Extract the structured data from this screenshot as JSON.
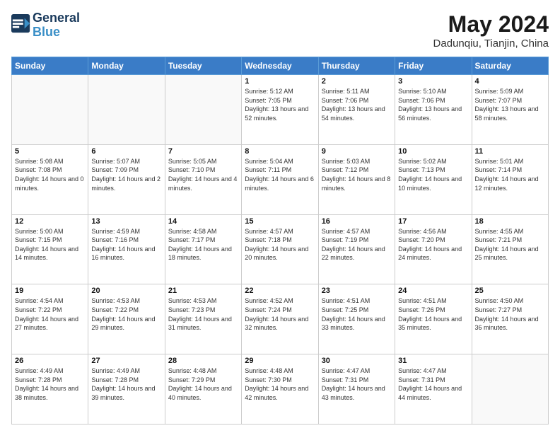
{
  "header": {
    "logo_line1": "General",
    "logo_line2": "Blue",
    "title": "May 2024",
    "subtitle": "Dadunqiu, Tianjin, China"
  },
  "weekdays": [
    "Sunday",
    "Monday",
    "Tuesday",
    "Wednesday",
    "Thursday",
    "Friday",
    "Saturday"
  ],
  "weeks": [
    [
      {
        "day": "",
        "info": ""
      },
      {
        "day": "",
        "info": ""
      },
      {
        "day": "",
        "info": ""
      },
      {
        "day": "1",
        "info": "Sunrise: 5:12 AM\nSunset: 7:05 PM\nDaylight: 13 hours and 52 minutes."
      },
      {
        "day": "2",
        "info": "Sunrise: 5:11 AM\nSunset: 7:06 PM\nDaylight: 13 hours and 54 minutes."
      },
      {
        "day": "3",
        "info": "Sunrise: 5:10 AM\nSunset: 7:06 PM\nDaylight: 13 hours and 56 minutes."
      },
      {
        "day": "4",
        "info": "Sunrise: 5:09 AM\nSunset: 7:07 PM\nDaylight: 13 hours and 58 minutes."
      }
    ],
    [
      {
        "day": "5",
        "info": "Sunrise: 5:08 AM\nSunset: 7:08 PM\nDaylight: 14 hours and 0 minutes."
      },
      {
        "day": "6",
        "info": "Sunrise: 5:07 AM\nSunset: 7:09 PM\nDaylight: 14 hours and 2 minutes."
      },
      {
        "day": "7",
        "info": "Sunrise: 5:05 AM\nSunset: 7:10 PM\nDaylight: 14 hours and 4 minutes."
      },
      {
        "day": "8",
        "info": "Sunrise: 5:04 AM\nSunset: 7:11 PM\nDaylight: 14 hours and 6 minutes."
      },
      {
        "day": "9",
        "info": "Sunrise: 5:03 AM\nSunset: 7:12 PM\nDaylight: 14 hours and 8 minutes."
      },
      {
        "day": "10",
        "info": "Sunrise: 5:02 AM\nSunset: 7:13 PM\nDaylight: 14 hours and 10 minutes."
      },
      {
        "day": "11",
        "info": "Sunrise: 5:01 AM\nSunset: 7:14 PM\nDaylight: 14 hours and 12 minutes."
      }
    ],
    [
      {
        "day": "12",
        "info": "Sunrise: 5:00 AM\nSunset: 7:15 PM\nDaylight: 14 hours and 14 minutes."
      },
      {
        "day": "13",
        "info": "Sunrise: 4:59 AM\nSunset: 7:16 PM\nDaylight: 14 hours and 16 minutes."
      },
      {
        "day": "14",
        "info": "Sunrise: 4:58 AM\nSunset: 7:17 PM\nDaylight: 14 hours and 18 minutes."
      },
      {
        "day": "15",
        "info": "Sunrise: 4:57 AM\nSunset: 7:18 PM\nDaylight: 14 hours and 20 minutes."
      },
      {
        "day": "16",
        "info": "Sunrise: 4:57 AM\nSunset: 7:19 PM\nDaylight: 14 hours and 22 minutes."
      },
      {
        "day": "17",
        "info": "Sunrise: 4:56 AM\nSunset: 7:20 PM\nDaylight: 14 hours and 24 minutes."
      },
      {
        "day": "18",
        "info": "Sunrise: 4:55 AM\nSunset: 7:21 PM\nDaylight: 14 hours and 25 minutes."
      }
    ],
    [
      {
        "day": "19",
        "info": "Sunrise: 4:54 AM\nSunset: 7:22 PM\nDaylight: 14 hours and 27 minutes."
      },
      {
        "day": "20",
        "info": "Sunrise: 4:53 AM\nSunset: 7:22 PM\nDaylight: 14 hours and 29 minutes."
      },
      {
        "day": "21",
        "info": "Sunrise: 4:53 AM\nSunset: 7:23 PM\nDaylight: 14 hours and 31 minutes."
      },
      {
        "day": "22",
        "info": "Sunrise: 4:52 AM\nSunset: 7:24 PM\nDaylight: 14 hours and 32 minutes."
      },
      {
        "day": "23",
        "info": "Sunrise: 4:51 AM\nSunset: 7:25 PM\nDaylight: 14 hours and 33 minutes."
      },
      {
        "day": "24",
        "info": "Sunrise: 4:51 AM\nSunset: 7:26 PM\nDaylight: 14 hours and 35 minutes."
      },
      {
        "day": "25",
        "info": "Sunrise: 4:50 AM\nSunset: 7:27 PM\nDaylight: 14 hours and 36 minutes."
      }
    ],
    [
      {
        "day": "26",
        "info": "Sunrise: 4:49 AM\nSunset: 7:28 PM\nDaylight: 14 hours and 38 minutes."
      },
      {
        "day": "27",
        "info": "Sunrise: 4:49 AM\nSunset: 7:28 PM\nDaylight: 14 hours and 39 minutes."
      },
      {
        "day": "28",
        "info": "Sunrise: 4:48 AM\nSunset: 7:29 PM\nDaylight: 14 hours and 40 minutes."
      },
      {
        "day": "29",
        "info": "Sunrise: 4:48 AM\nSunset: 7:30 PM\nDaylight: 14 hours and 42 minutes."
      },
      {
        "day": "30",
        "info": "Sunrise: 4:47 AM\nSunset: 7:31 PM\nDaylight: 14 hours and 43 minutes."
      },
      {
        "day": "31",
        "info": "Sunrise: 4:47 AM\nSunset: 7:31 PM\nDaylight: 14 hours and 44 minutes."
      },
      {
        "day": "",
        "info": ""
      }
    ]
  ]
}
